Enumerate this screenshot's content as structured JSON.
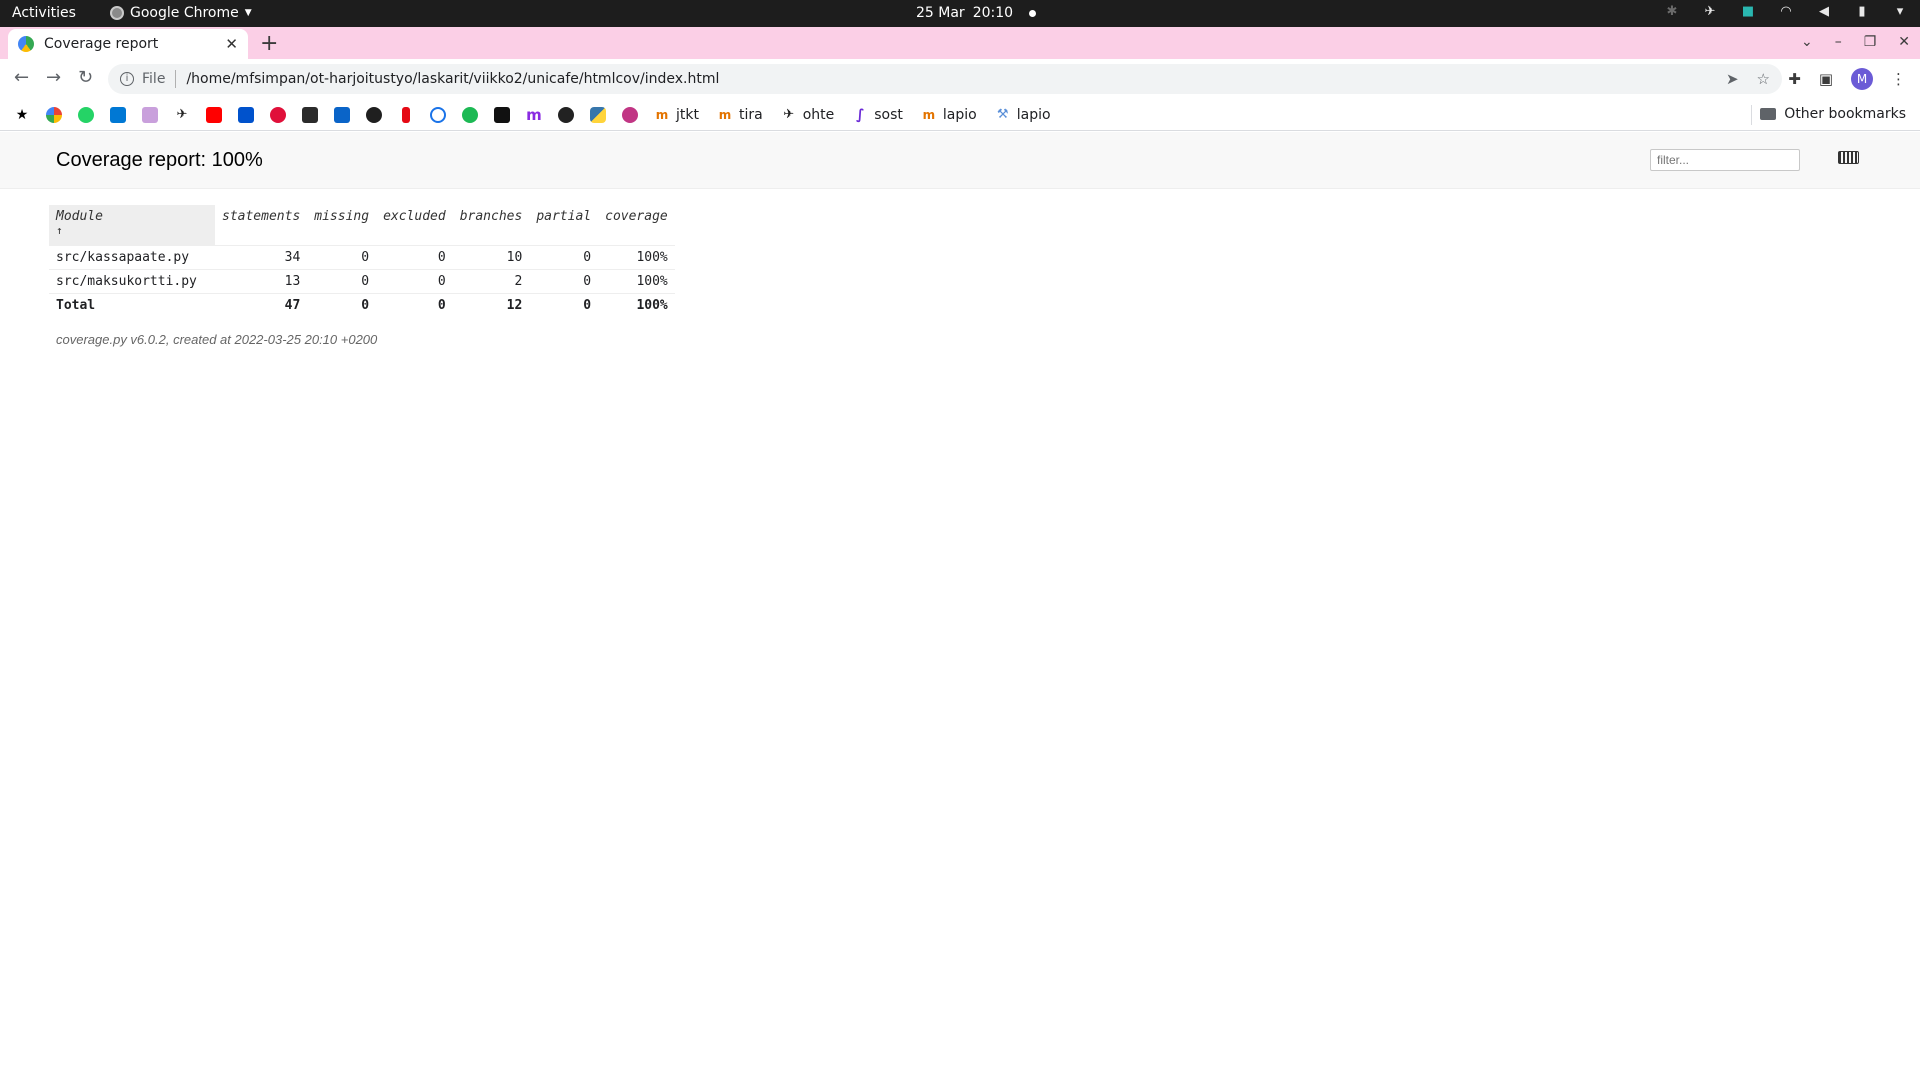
{
  "topbar": {
    "activities": "Activities",
    "app_name": "Google Chrome",
    "date": "25 Mar",
    "time": "20:10"
  },
  "browser": {
    "tab_title": "Coverage report",
    "address_scheme": "File",
    "address_url": "/home/mfsimpan/ot-harjoitustyo/laskarit/viikko2/unicafe/htmlcov/index.html",
    "avatar_letter": "M",
    "tabstrip_color": "#fbcfe6"
  },
  "bookmarks": {
    "icons": [
      "star-icon",
      "google-icon",
      "whatsapp-icon",
      "outlook-icon",
      "calendar-icon",
      "bird-icon",
      "youtube-icon",
      "trello-icon",
      "arrow-icon",
      "s-icon",
      "outlook2-icon",
      "xbox-icon",
      "netflix-icon",
      "circle-icon",
      "spotify-icon",
      "chart-icon",
      "m-icon",
      "github-icon",
      "python-icon",
      "messenger-icon"
    ],
    "labeled": [
      {
        "label": "jtkt"
      },
      {
        "label": "tira"
      },
      {
        "label": "ohte"
      },
      {
        "label": "sost"
      },
      {
        "label": "lapio"
      },
      {
        "label": "lapio"
      }
    ],
    "other": "Other bookmarks"
  },
  "report": {
    "title": "Coverage report: 100%",
    "filter_placeholder": "filter...",
    "columns": {
      "module": "Module",
      "sort_arrow": "↑",
      "statements": "statements",
      "missing": "missing",
      "excluded": "excluded",
      "branches": "branches",
      "partial": "partial",
      "coverage": "coverage"
    },
    "rows": [
      {
        "module": "src/kassapaate.py",
        "statements": "34",
        "missing": "0",
        "excluded": "0",
        "branches": "10",
        "partial": "0",
        "coverage": "100%"
      },
      {
        "module": "src/maksukortti.py",
        "statements": "13",
        "missing": "0",
        "excluded": "0",
        "branches": "2",
        "partial": "0",
        "coverage": "100%"
      }
    ],
    "total": {
      "module": "Total",
      "statements": "47",
      "missing": "0",
      "excluded": "0",
      "branches": "12",
      "partial": "0",
      "coverage": "100%"
    },
    "footer": "coverage.py v6.0.2, created at 2022-03-25 20:10 +0200"
  }
}
